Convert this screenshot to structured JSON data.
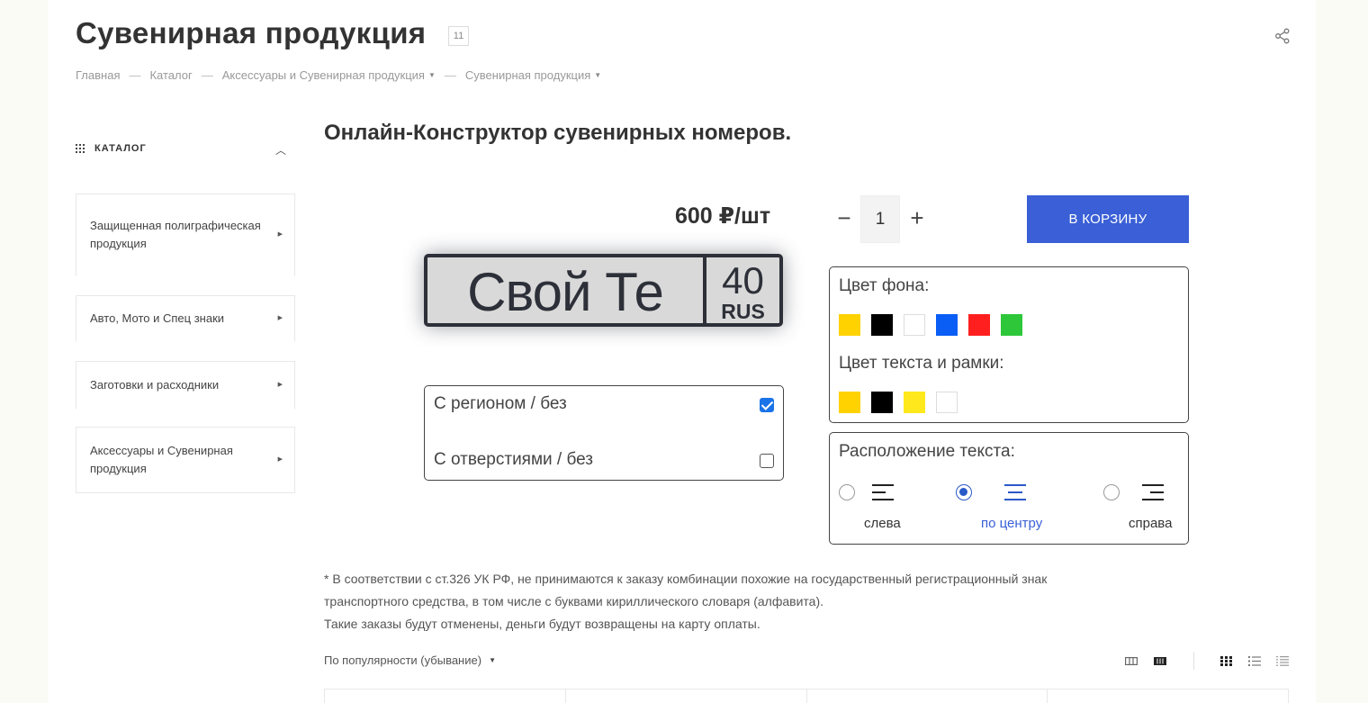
{
  "header": {
    "title": "Сувенирная продукция",
    "count": "11",
    "share_icon": "share-icon"
  },
  "breadcrumbs": [
    {
      "label": "Главная",
      "dropdown": false
    },
    {
      "label": "Каталог",
      "dropdown": false
    },
    {
      "label": "Аксессуары и Сувенирная продукция",
      "dropdown": true
    },
    {
      "label": "Сувенирная продукция",
      "dropdown": true
    }
  ],
  "breadcrumb_separator": "—",
  "sidebar": {
    "heading": "КАТАЛОГ",
    "items": [
      {
        "label": "Защищенная полиграфическая продукция"
      },
      {
        "label": "Авто, Мото и Спец знаки"
      },
      {
        "label": "Заготовки и расходники"
      },
      {
        "label": "Аксессуары и Сувенирная продукция"
      }
    ]
  },
  "constructor": {
    "title": "Онлайн-Конструктор сувенирных номеров.",
    "price": "600 ₽/шт",
    "plate": {
      "text": "Свой Те",
      "region": "40",
      "country": "RUS"
    },
    "options": [
      {
        "label": "С регионом / без",
        "checked": true
      },
      {
        "label": "С отверстиями / без",
        "checked": false
      }
    ],
    "quantity": {
      "minus": "−",
      "value": "1",
      "plus": "+"
    },
    "cart_button": "В КОРЗИНУ",
    "bg_color_label": "Цвет фона:",
    "bg_colors": [
      "#ffd200",
      "#000000",
      "#ffffff",
      "#0a5ef5",
      "#ff1f1f",
      "#2ec73a"
    ],
    "text_color_label": "Цвет текста и рамки:",
    "text_colors": [
      "#ffd200",
      "#000000",
      "#ffe81c",
      "#ffffff"
    ],
    "position_label": "Расположение текста:",
    "positions": [
      {
        "label": "слева",
        "selected": false,
        "icon": "align-left-icon"
      },
      {
        "label": "по центру",
        "selected": true,
        "icon": "align-center-icon"
      },
      {
        "label": "справа",
        "selected": false,
        "icon": "align-right-icon"
      }
    ]
  },
  "note": {
    "line1": "* В соответствии с ст.326 УК РФ, не принимаются к заказу комбинации похожие на государственный регистрационный знак",
    "line2": "транспортного средства, в том числе с буквами кириллического словаря (алфавита).",
    "line3": "Такие заказы будут отменены, деньги будут возвращены на карту оплаты."
  },
  "sort": {
    "label": "По популярности (убывание)"
  },
  "colors": {
    "accent": "#3a5fd6",
    "checkbox": "#1a73e8",
    "plate_bg": "#d9d9d9",
    "plate_ink": "#2d3038"
  }
}
